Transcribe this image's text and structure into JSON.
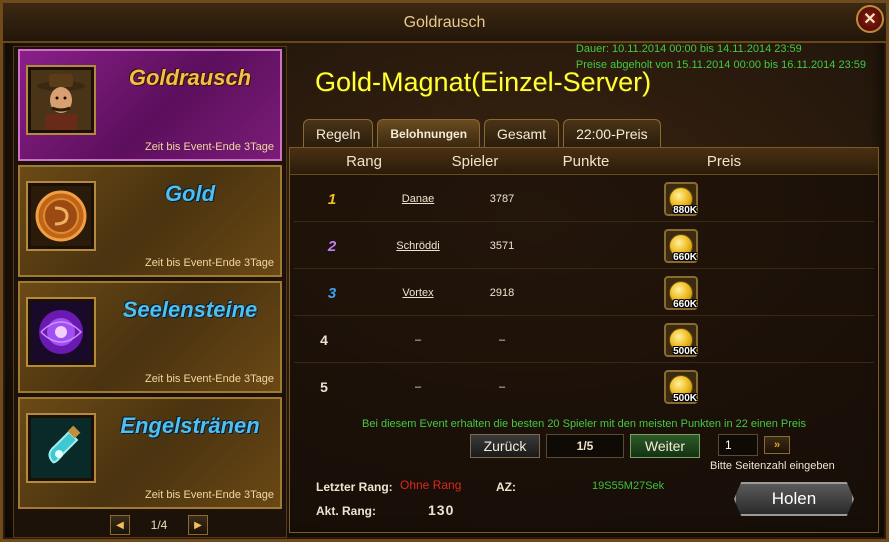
{
  "window": {
    "title": "Goldrausch",
    "close_label": "✕"
  },
  "events": [
    {
      "name": "Goldrausch",
      "time": "Zeit bis Event-Ende 3Tage",
      "icon": "miner-portrait-icon",
      "active": true
    },
    {
      "name": "Gold",
      "time": "Zeit bis Event-Ende 3Tage",
      "icon": "gold-coin-icon",
      "active": false
    },
    {
      "name": "Seelensteine",
      "time": "Zeit bis Event-Ende 3Tage",
      "icon": "soul-stone-icon",
      "active": false
    },
    {
      "name": "Engelstränen",
      "time": "Zeit bis Event-Ende 3Tage",
      "icon": "angel-tear-icon",
      "active": false
    }
  ],
  "left_pager": {
    "prev": "◀",
    "page": "1/4",
    "next": "▶"
  },
  "dates": {
    "duration": "Dauer: 10.11.2014 00:00 bis 14.11.2014 23:59",
    "claim": "Preise abgeholt von 15.11.2014 00:00 bis 16.11.2014 23:59"
  },
  "heading": "Gold-Magnat(Einzel-Server)",
  "tabs": [
    "Regeln",
    "Belohnungen",
    "Gesamt",
    "22:00-Preis"
  ],
  "active_tab": "Belohnungen",
  "table": {
    "headers": [
      "Rang",
      "Spieler",
      "Punkte",
      "Preis"
    ],
    "rows": [
      {
        "rank": "1",
        "player": "Danae",
        "points": "3787",
        "reward": "880K",
        "rank_color": "#f0c020"
      },
      {
        "rank": "2",
        "player": "Schröddi",
        "points": "3571",
        "reward": "660K",
        "rank_color": "#c080f0"
      },
      {
        "rank": "3",
        "player": "Vortex",
        "points": "2918",
        "reward": "660K",
        "rank_color": "#40a0f0"
      },
      {
        "rank": "4",
        "player": "–",
        "points": "–",
        "reward": "500K",
        "rank_color": "#ede4d0"
      },
      {
        "rank": "5",
        "player": "–",
        "points": "–",
        "reward": "500K",
        "rank_color": "#ede4d0"
      }
    ]
  },
  "info_text": "Bei diesem Event erhalten die besten 20 Spieler mit den meisten Punkten in 22 einen Preis",
  "pager": {
    "back": "Zurück",
    "page": "1/5",
    "next": "Weiter",
    "input_value": "1",
    "go": "»",
    "hint": "Bitte Seitenzahl eingeben"
  },
  "status": {
    "last_rank_label": "Letzter Rang:",
    "last_rank_value": "Ohne Rang",
    "az_label": "AZ:",
    "az_value": "19S55M27Sek",
    "current_rank_label": "Akt. Rang:",
    "current_rank_value": "130"
  },
  "claim_button": "Holen"
}
